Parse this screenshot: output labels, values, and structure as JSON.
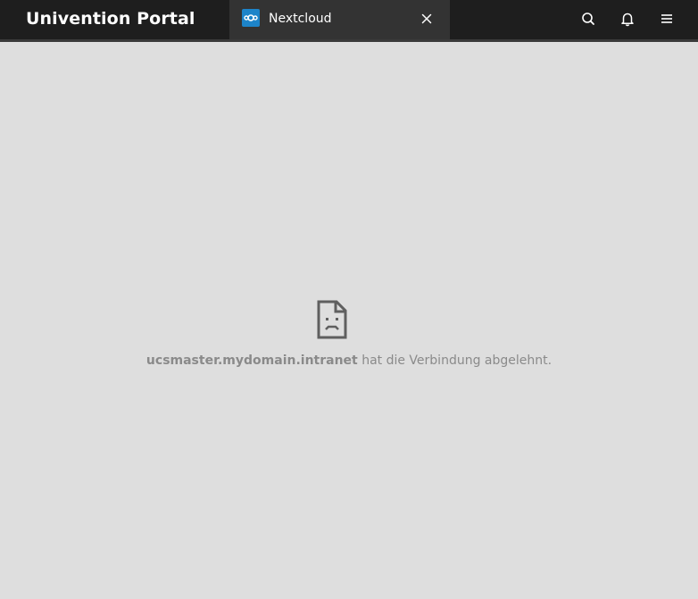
{
  "header": {
    "title": "Univention Portal",
    "tab": {
      "label": "Nextcloud",
      "icon": "nextcloud-icon"
    },
    "icons": {
      "search": "search-icon",
      "notifications": "bell-icon",
      "menu": "hamburger-menu-icon",
      "close_tab": "close-icon"
    }
  },
  "error_page": {
    "icon": "broken-page-icon",
    "host": "ucsmaster.mydomain.intranet",
    "message": " hat die Verbindung abgelehnt."
  },
  "colors": {
    "topbar": "#1e1e1e",
    "tab": "#333333",
    "background": "#dedede",
    "nextcloud_blue": "#1d84c9"
  }
}
